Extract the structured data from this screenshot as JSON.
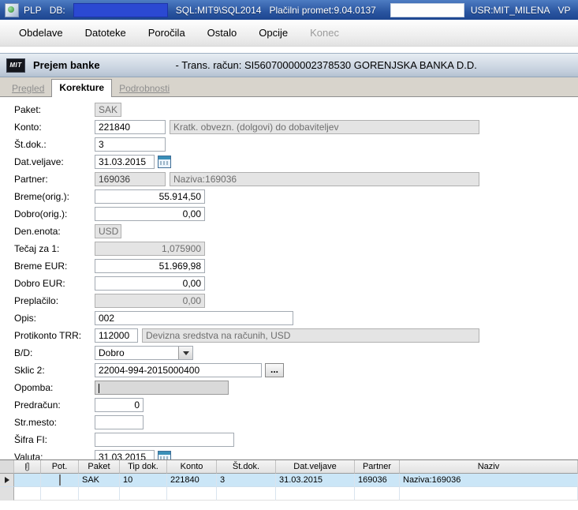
{
  "titlebar": {
    "app_label": "PLP",
    "db_label": "DB:",
    "sql_label": "SQL:MIT9\\SQL2014",
    "promet_label": "Plačilni promet:9.04.0137",
    "user_label": "USR:MIT_MILENA",
    "extra_label": "VP"
  },
  "menubar": {
    "items": [
      {
        "label": "Obdelave"
      },
      {
        "label": "Datoteke"
      },
      {
        "label": "Poročila"
      },
      {
        "label": "Ostalo"
      },
      {
        "label": "Opcije"
      },
      {
        "label": "Konec"
      }
    ]
  },
  "header": {
    "logo": "MIT",
    "title": "Prejem banke",
    "subtitle": "- Trans. račun: SI56070000002378530  GORENJSKA BANKA D.D."
  },
  "tabs": [
    {
      "label": "Pregled",
      "state": "disabled"
    },
    {
      "label": "Korekture",
      "state": "active"
    },
    {
      "label": "Podrobnosti",
      "state": "disabled"
    }
  ],
  "form": {
    "paket": {
      "label": "Paket:",
      "value": "SAK"
    },
    "konto": {
      "label": "Konto:",
      "value": "221840",
      "desc": "Kratk. obvezn. (dolgovi) do dobaviteljev"
    },
    "st_dok": {
      "label": "Št.dok.:",
      "value": "3"
    },
    "dat_veljave": {
      "label": "Dat.veljave:",
      "value": "31.03.2015"
    },
    "partner": {
      "label": "Partner:",
      "value": "169036",
      "desc": "Naziva:169036"
    },
    "breme_orig": {
      "label": "Breme(orig.):",
      "value": "55.914,50"
    },
    "dobro_orig": {
      "label": "Dobro(orig.):",
      "value": "0,00"
    },
    "den_enota": {
      "label": "Den.enota:",
      "value": "USD"
    },
    "tecaj_za_1": {
      "label": "Tečaj za 1:",
      "value": "1,075900"
    },
    "breme_eur": {
      "label": "Breme EUR:",
      "value": "51.969,98"
    },
    "dobro_eur": {
      "label": "Dobro EUR:",
      "value": "0,00"
    },
    "preplacilo": {
      "label": "Preplačilo:",
      "value": "0,00"
    },
    "opis": {
      "label": "Opis:",
      "value": "002"
    },
    "protikonto_trr": {
      "label": "Protikonto TRR:",
      "value": "112000",
      "desc": "Devizna sredstva na računih, USD"
    },
    "bd": {
      "label": "B/D:",
      "value": "Dobro"
    },
    "sklic2": {
      "label": "Sklic 2:",
      "value": "22004-994-2015000400",
      "button": "..."
    },
    "opomba": {
      "label": "Opomba:",
      "value": ""
    },
    "predracun": {
      "label": "Predračun:",
      "value": "0"
    },
    "str_mesto": {
      "label": "Str.mesto:",
      "value": ""
    },
    "sifra_fi": {
      "label": "Šifra FI:",
      "value": ""
    },
    "valuta": {
      "label": "Valuta:",
      "value": "31.03.2015"
    }
  },
  "grid": {
    "columns": [
      "Pot.",
      "Paket",
      "Tip dok.",
      "Konto",
      "Št.dok.",
      "Dat.veljave",
      "Partner",
      "Naziv"
    ],
    "rows": [
      {
        "pot": false,
        "paket": "SAK",
        "tip_dok": "10",
        "konto": "221840",
        "st_dok": "3",
        "dat_veljave": "31.03.2015",
        "partner": "169036",
        "naziv": "Naziva:169036"
      }
    ]
  }
}
